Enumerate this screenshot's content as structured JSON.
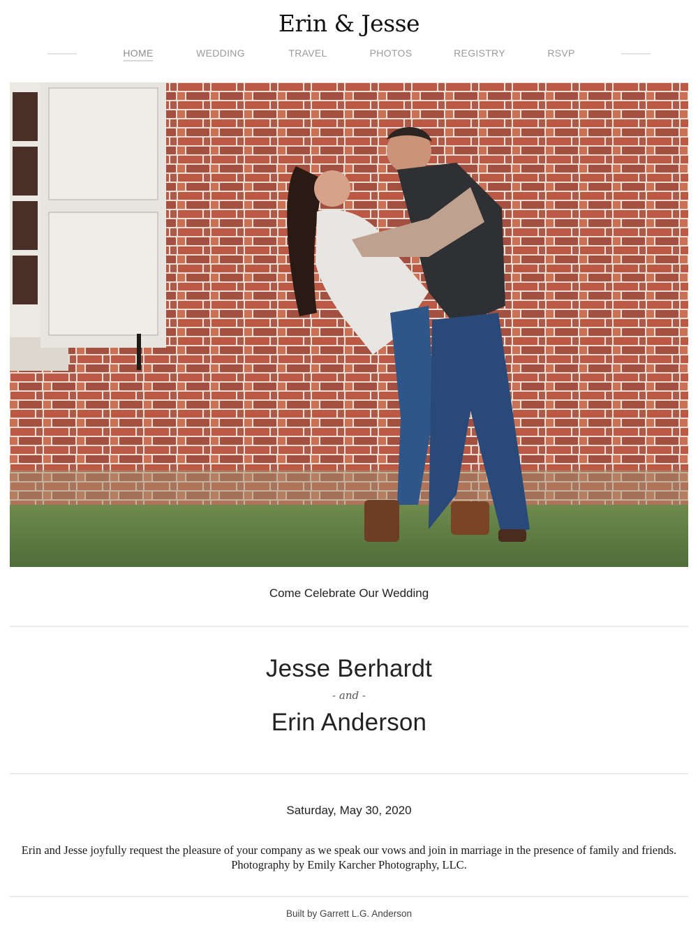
{
  "header": {
    "title": "Erin & Jesse"
  },
  "nav": {
    "items": [
      {
        "label": "HOME",
        "active": true
      },
      {
        "label": "WEDDING",
        "active": false
      },
      {
        "label": "TRAVEL",
        "active": false
      },
      {
        "label": "PHOTOS",
        "active": false
      },
      {
        "label": "REGISTRY",
        "active": false
      },
      {
        "label": "RSVP",
        "active": false
      }
    ]
  },
  "main": {
    "tagline": "Come Celebrate Our Wedding",
    "groom": "Jesse Berhardt",
    "and_text": "- and -",
    "bride": "Erin Anderson",
    "date": "Saturday, May 30, 2020",
    "invitation": "Erin and Jesse joyfully request the pleasure of your company as we speak our vows and join in marriage in the presence of family and friends.",
    "photo_credit": "Photography by Emily Karcher Photography, LLC."
  },
  "footer": {
    "credit": "Built by Garrett L.G. Anderson"
  },
  "colors": {
    "brick": "#b5553f",
    "mortar": "#e9e3dc",
    "grass": "#5f7d45",
    "shutter": "#e7e5df"
  }
}
